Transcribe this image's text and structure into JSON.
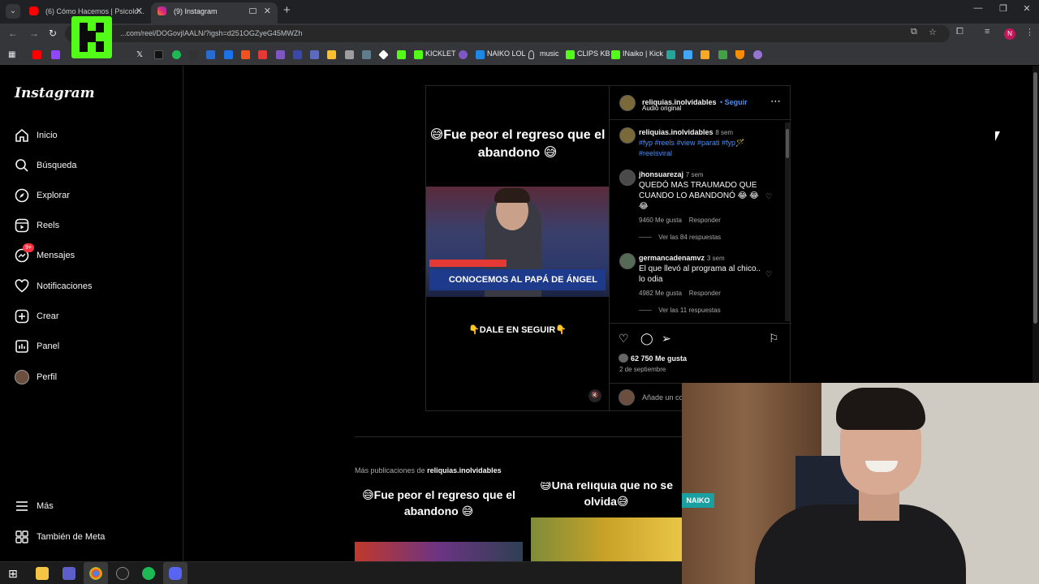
{
  "browser": {
    "tabs": [
      {
        "title": "(6) Cómo Hacemos | Psicolo...",
        "active": false
      },
      {
        "title": "(9) Instagram",
        "active": true
      }
    ],
    "url": "...com/reel/DOGovjIAALN/?igsh=d251OGZyeG45MWZh",
    "bookmarks": [
      "KICKLET",
      "NAIKO LOL",
      "music",
      "CLIPS KB",
      "INaiko | Kick"
    ],
    "profile_initial": "N"
  },
  "sidebar": {
    "logo": "Instagram",
    "items": [
      {
        "label": "Inicio",
        "icon": "home-icon"
      },
      {
        "label": "Búsqueda",
        "icon": "search-icon"
      },
      {
        "label": "Explorar",
        "icon": "compass-icon"
      },
      {
        "label": "Reels",
        "icon": "reels-icon"
      },
      {
        "label": "Mensajes",
        "icon": "messenger-icon",
        "badge": "9+"
      },
      {
        "label": "Notificaciones",
        "icon": "heart-icon"
      },
      {
        "label": "Crear",
        "icon": "plus-square-icon"
      },
      {
        "label": "Panel",
        "icon": "dashboard-icon"
      },
      {
        "label": "Perfil",
        "icon": "avatar"
      }
    ],
    "bottom": [
      {
        "label": "Más",
        "icon": "menu-icon"
      },
      {
        "label": "También de Meta",
        "icon": "meta-icon"
      }
    ]
  },
  "post": {
    "video": {
      "caption_top": "😅Fue peor el regreso que el abandono 😅",
      "banner_text": "CONOCEMOS AL PAPÁ DE ÁNGEL",
      "caption_bottom": "👇DALE EN SEGUIR👇"
    },
    "author": "reliquias.inolvidables",
    "follow_label": "Seguir",
    "audio": "Audio original",
    "caption": {
      "user": "reliquias.inolvidables",
      "time": "8 sem",
      "text": "#fyp #reels #view #parati #fyp🪄 #reelsviral"
    },
    "comments": [
      {
        "user": "jhonsuarezaj",
        "time": "7 sem",
        "text": "QUEDÓ MAS TRAUMADO QUE CUANDO LO ABANDONÓ 😂 😂 😂",
        "likes": "9460 Me gusta",
        "reply": "Responder",
        "view_replies": "Ver las 84 respuestas"
      },
      {
        "user": "germancadenamvz",
        "time": "3 sem",
        "text": "El que llevó al programa al chico.. lo odia",
        "likes": "4982 Me gusta",
        "reply": "Responder",
        "view_replies": "Ver las 11 respuestas"
      }
    ],
    "likes": "62 750 Me gusta",
    "date": "2 de septiembre",
    "add_comment_placeholder": "Añade un co"
  },
  "more": {
    "prefix": "Más publicaciones de",
    "user": "reliquias.inolvidables",
    "thumbs": [
      {
        "caption": "😅Fue peor el regreso que el abandono 😅"
      },
      {
        "caption": "😅Una reliquia que no se olvida😅"
      }
    ]
  },
  "webcam": {
    "overlay_text": "NAIKO"
  },
  "colors": {
    "accent_link": "#4f8ef7",
    "badge": "#ff3040",
    "kick_green": "#53fc18"
  }
}
